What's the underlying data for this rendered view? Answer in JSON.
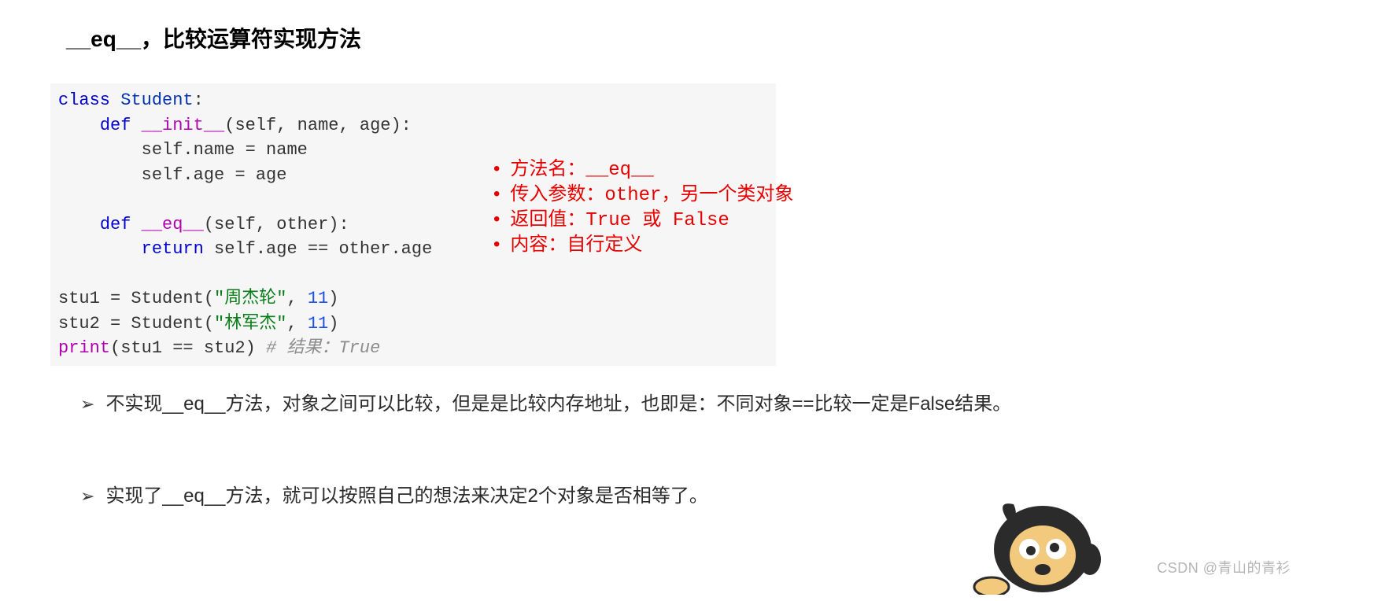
{
  "title": "__eq__，比较运算符实现方法",
  "code": {
    "l1_kw": "class",
    "l1_name": "Student",
    "l1_colon": ":",
    "l2_indent": "    ",
    "l2_kw": "def",
    "l2_fn": "__init__",
    "l2_sig": "(self, name, age):",
    "l3_indent": "        ",
    "l3_text": "self.name = name",
    "l4_indent": "        ",
    "l4_text": "self.age = age",
    "l5_blank": "",
    "l6_indent": "    ",
    "l6_kw": "def",
    "l6_fn": "__eq__",
    "l6_sig": "(self, other):",
    "l7_indent": "        ",
    "l7_kw": "return",
    "l7_expr": " self.age == other.age",
    "l8_blank": "",
    "l9_text_a": "stu1 = Student(",
    "l9_str": "\"周杰轮\"",
    "l9_text_b": ", ",
    "l9_num": "11",
    "l9_text_c": ")",
    "l10_text_a": "stu2 = Student(",
    "l10_str": "\"林军杰\"",
    "l10_text_b": ", ",
    "l10_num": "11",
    "l10_text_c": ")",
    "l11_fn": "print",
    "l11_text_a": "(stu1 == stu2) ",
    "l11_comment": "# 结果：True"
  },
  "bullets": {
    "b1": "方法名：__eq__",
    "b2": "传入参数：other，另一个类对象",
    "b3": "返回值：True 或 False",
    "b4": "内容：自行定义"
  },
  "notes": {
    "n1": "不实现__eq__方法，对象之间可以比较，但是是比较内存地址，也即是：不同对象==比较一定是False结果。",
    "n2": "实现了__eq__方法，就可以按照自己的想法来决定2个对象是否相等了。"
  },
  "watermark": "CSDN @青山的青衫"
}
